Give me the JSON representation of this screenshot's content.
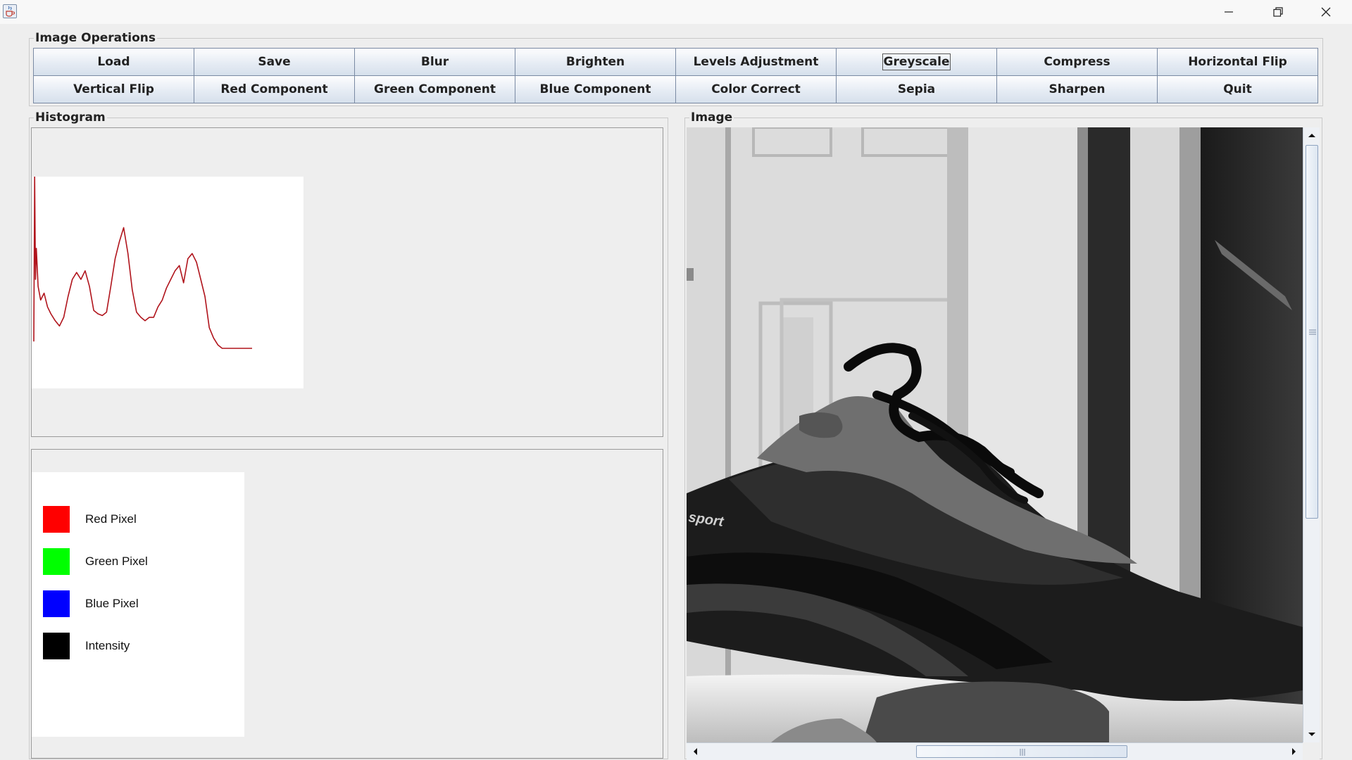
{
  "window": {
    "app_icon": "java-cup-icon",
    "controls": [
      "minimize-icon",
      "restore-icon",
      "close-icon"
    ]
  },
  "operations": {
    "title": "Image Operations",
    "buttons": [
      "Load",
      "Save",
      "Blur",
      "Brighten",
      "Levels Adjustment",
      "Greyscale",
      "Compress",
      "Horizontal Flip",
      "Vertical Flip",
      "Red Component",
      "Green Component",
      "Blue Component",
      "Color Correct",
      "Sepia",
      "Sharpen",
      "Quit"
    ],
    "focused_button": "Greyscale"
  },
  "histogram": {
    "title": "Histogram",
    "legend": [
      {
        "label": "Red Pixel",
        "color": "#ff0000"
      },
      {
        "label": "Green Pixel",
        "color": "#00ff00"
      },
      {
        "label": "Blue Pixel",
        "color": "#0000ff"
      },
      {
        "label": "Intensity",
        "color": "#000000"
      }
    ],
    "line_color": "#b0141c"
  },
  "chart_data": {
    "type": "line",
    "title": "",
    "xlabel": "",
    "ylabel": "",
    "xlim": [
      0,
      255
    ],
    "ylim": [
      0,
      100
    ],
    "grid": false,
    "series": [
      {
        "color": "#b0141c",
        "x": [
          0,
          1,
          2,
          3,
          5,
          8,
          12,
          16,
          20,
          25,
          30,
          35,
          40,
          45,
          50,
          55,
          60,
          65,
          70,
          75,
          80,
          85,
          90,
          95,
          100,
          105,
          110,
          115,
          120,
          125,
          130,
          135,
          140,
          145,
          150,
          155,
          160,
          165,
          170,
          175,
          180,
          185,
          190,
          195,
          200,
          205,
          210,
          215,
          220,
          225,
          230,
          235,
          240,
          245,
          250,
          253,
          255
        ],
        "values": [
          4,
          100,
          40,
          58,
          36,
          28,
          32,
          24,
          20,
          16,
          13,
          18,
          30,
          40,
          44,
          40,
          45,
          36,
          22,
          20,
          19,
          21,
          36,
          52,
          62,
          70,
          55,
          34,
          21,
          18,
          16,
          18,
          18,
          24,
          28,
          35,
          40,
          45,
          48,
          38,
          52,
          55,
          50,
          40,
          30,
          12,
          6,
          2,
          0,
          0,
          0,
          0,
          0,
          0,
          0,
          0,
          0
        ]
      }
    ]
  },
  "image_panel": {
    "title": "Image",
    "content": "greyscale photo of a sneaker in front of a white door",
    "watermark_text": "sport"
  }
}
